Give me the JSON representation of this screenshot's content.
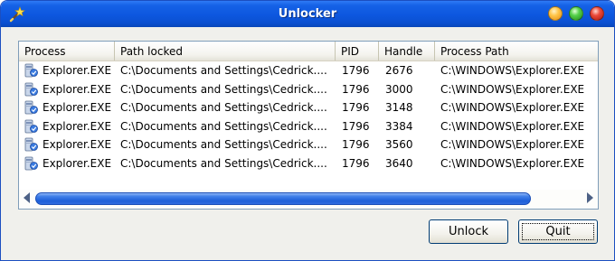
{
  "window": {
    "title": "Unlocker"
  },
  "columns": [
    "Process",
    "Path locked",
    "PID",
    "Handle",
    "Process Path"
  ],
  "rows": [
    {
      "process": "Explorer.EXE",
      "path_locked": "C:\\Documents and Settings\\Cedrick....",
      "pid": "1796",
      "handle": "2676",
      "process_path": "C:\\WINDOWS\\Explorer.EXE"
    },
    {
      "process": "Explorer.EXE",
      "path_locked": "C:\\Documents and Settings\\Cedrick....",
      "pid": "1796",
      "handle": "3000",
      "process_path": "C:\\WINDOWS\\Explorer.EXE"
    },
    {
      "process": "Explorer.EXE",
      "path_locked": "C:\\Documents and Settings\\Cedrick....",
      "pid": "1796",
      "handle": "3148",
      "process_path": "C:\\WINDOWS\\Explorer.EXE"
    },
    {
      "process": "Explorer.EXE",
      "path_locked": "C:\\Documents and Settings\\Cedrick....",
      "pid": "1796",
      "handle": "3384",
      "process_path": "C:\\WINDOWS\\Explorer.EXE"
    },
    {
      "process": "Explorer.EXE",
      "path_locked": "C:\\Documents and Settings\\Cedrick....",
      "pid": "1796",
      "handle": "3560",
      "process_path": "C:\\WINDOWS\\Explorer.EXE"
    },
    {
      "process": "Explorer.EXE",
      "path_locked": "C:\\Documents and Settings\\Cedrick....",
      "pid": "1796",
      "handle": "3640",
      "process_path": "C:\\WINDOWS\\Explorer.EXE"
    }
  ],
  "buttons": {
    "unlock": "Unlock",
    "quit": "Quit"
  },
  "icons": {
    "app": "wand-icon",
    "process": "process-icon",
    "minimize": "minimize-icon",
    "maximize": "maximize-icon",
    "close": "close-icon"
  },
  "colors": {
    "titlebar": "#0b4fd0",
    "scroll_thumb": "#1d5fd8",
    "list_border": "#7f9db9"
  }
}
